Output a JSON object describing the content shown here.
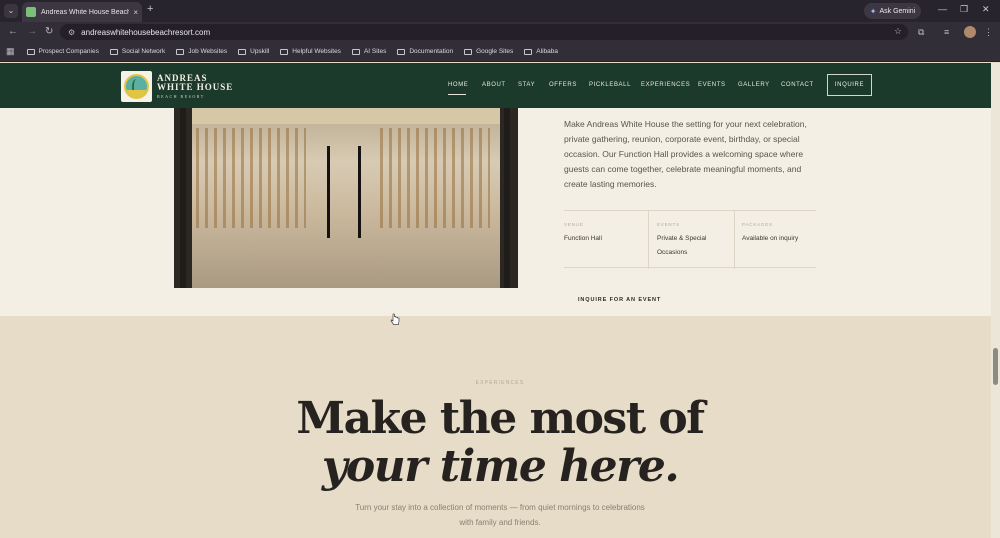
{
  "browser": {
    "tab_title": "Andreas White House Beach R...",
    "tab_close": "×",
    "new_tab": "+",
    "ask_gemini": "Ask Gemini",
    "url": "andreaswhitehousebeachresort.com",
    "bookmarks": [
      "Prospect Companies",
      "Social Network",
      "Job Websites",
      "Upskill",
      "Helpful Websites",
      "AI Sites",
      "Documentation",
      "Google Sites",
      "Alibaba"
    ]
  },
  "site": {
    "brand_line1": "ANDREAS",
    "brand_line2": "WHITE HOUSE",
    "brand_line3": "BEACH RESORT",
    "nav": [
      "HOME",
      "ABOUT",
      "STAY",
      "OFFERS",
      "PICKLEBALL",
      "EXPERIENCES",
      "EVENTS",
      "GALLERY",
      "CONTACT"
    ],
    "nav_active": "HOME",
    "inquire_button": "INQUIRE"
  },
  "hall": {
    "description": "Make Andreas White House the setting for your next celebration, private gathering, reunion, corporate event, birthday, or special occasion. Our Function Hall provides a welcoming space where guests can come together, celebrate meaningful moments, and create lasting memories.",
    "info": [
      {
        "label": "VENUE",
        "value": "Function Hall"
      },
      {
        "label": "EVENTS",
        "value": "Private & Special Occasions"
      },
      {
        "label": "PACKAGES",
        "value": "Available on inquiry"
      }
    ],
    "inquire_link": "INQUIRE FOR AN EVENT"
  },
  "experiences": {
    "eyebrow": "EXPERIENCES",
    "heading_line1": "Make the most of",
    "heading_line2": "your time here.",
    "subtitle": "Turn your stay into a collection of moments — from quiet mornings to celebrations with family and friends."
  },
  "colors": {
    "header_green": "#1b3a2c",
    "cream": "#f3efe4",
    "sand": "#e6dcc8"
  }
}
